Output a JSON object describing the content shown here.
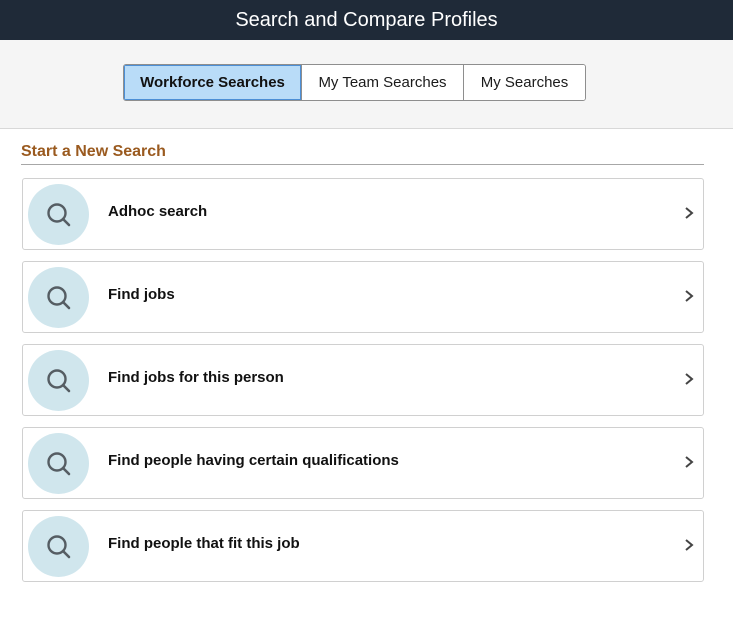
{
  "header": {
    "title": "Search and Compare Profiles"
  },
  "tabs": [
    {
      "label": "Workforce Searches",
      "active": true
    },
    {
      "label": "My Team Searches",
      "active": false
    },
    {
      "label": "My Searches",
      "active": false
    }
  ],
  "section": {
    "title": "Start a New Search"
  },
  "searches": [
    {
      "label": "Adhoc search",
      "icon": "search-icon"
    },
    {
      "label": "Find jobs",
      "icon": "search-icon"
    },
    {
      "label": "Find jobs for this person",
      "icon": "search-icon"
    },
    {
      "label": "Find people having certain qualifications",
      "icon": "search-icon"
    },
    {
      "label": "Find people that fit this job",
      "icon": "search-icon"
    }
  ],
  "colors": {
    "header_bg": "#1f2a38",
    "active_tab_bg": "#b9dcf8",
    "section_title": "#9a5a1f",
    "icon_circle": "#d0e6ed"
  }
}
